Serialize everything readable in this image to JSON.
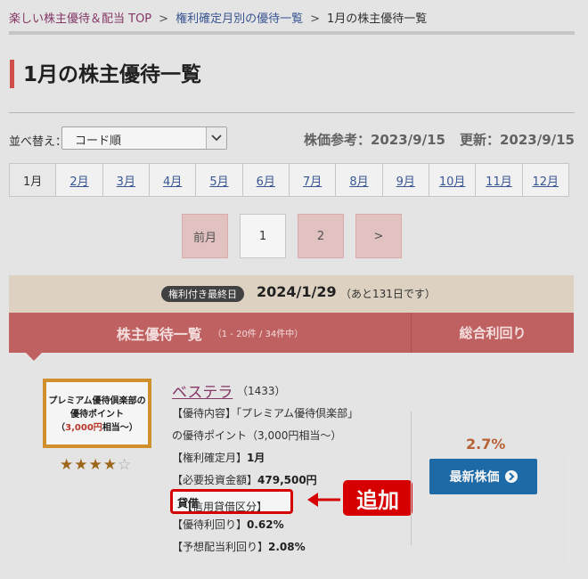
{
  "breadcrumb": {
    "home": "楽しい株主優待＆配当 TOP",
    "section": "権利確定月別の優待一覧",
    "current": "1月の株主優待一覧",
    "separator": ">"
  },
  "page_title": "1月の株主優待一覧",
  "sort": {
    "label": "並べ替え：",
    "selected": "コード順"
  },
  "price_ref": "株価参考：2023/9/15",
  "updated": "更新：2023/9/15",
  "months": [
    "1月",
    "2月",
    "3月",
    "4月",
    "5月",
    "6月",
    "7月",
    "8月",
    "9月",
    "10月",
    "11月",
    "12月"
  ],
  "pagination": {
    "prev": "前月",
    "page1": "1",
    "page2": "2",
    "next": ">"
  },
  "deadline": {
    "badge": "権利付き最終日",
    "date": "2024/1/29",
    "remaining": "（あと131日です）"
  },
  "list_header": {
    "title": "株主優待一覧",
    "count": "（1 - 20件 / 34件中）",
    "yield_col": "総合利回り"
  },
  "item": {
    "thumb_line1": "プレミアム優待倶楽部の",
    "thumb_line2": "優待ポイント",
    "thumb_line3_pre": "（",
    "thumb_value": "3,000円",
    "thumb_line3_post": "相当～）",
    "rating": 4,
    "rating_max": 5,
    "stars_on": "★★★★",
    "stars_off": "☆",
    "name": "ベステラ",
    "code": "（1433）",
    "benefit_line1": "【優待内容】「プレミアム優待倶楽部」",
    "benefit_line2": "の優待ポイント（3,000円相当～）",
    "record_month_label": "【権利確定月】",
    "record_month": "1月",
    "min_invest_label": "【必要投資金額】",
    "min_invest": "479,500円",
    "credit_label": "【信用貸借区分】",
    "credit": "貸借",
    "benefit_yield_label": "【優待利回り】",
    "benefit_yield": "0.62%",
    "dividend_yield_label": "【予想配当利回り】",
    "dividend_yield": "2.08%",
    "total_yield": "2.7%",
    "latest_price_button": "最新株価"
  },
  "annotation": {
    "label": "追加",
    "color": "#e00000"
  },
  "colors": {
    "accent": "#c86565",
    "link": "#3c5a9a",
    "button": "#1f6fae"
  }
}
